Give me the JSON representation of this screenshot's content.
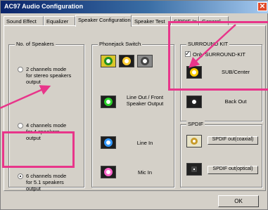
{
  "window": {
    "title": "AC97 Audio Configuration",
    "close_glyph": "✕"
  },
  "tabs": [
    {
      "label": "Sound Effect"
    },
    {
      "label": "Equalizer"
    },
    {
      "label": "Speaker Configuration"
    },
    {
      "label": "Speaker Test"
    },
    {
      "label": "S/PDIF-In"
    },
    {
      "label": "General"
    }
  ],
  "speakers_group": {
    "title": "No. of Speakers",
    "options": [
      {
        "label": "2 channels mode for stereo speakers output",
        "checked": false
      },
      {
        "label": "4 channels mode for 4 speakers output",
        "checked": false
      },
      {
        "label": "6 channels mode for 5.1 speakers output",
        "checked": true
      }
    ]
  },
  "phonejack_group": {
    "title": "Phonejack Switch",
    "jacks": [
      {
        "label": "Line Out / Front Speaker Output",
        "color": "#2bd12b"
      },
      {
        "label": "Line In",
        "color": "#3399ff"
      },
      {
        "label": "Mic In",
        "color": "#ff66cc"
      }
    ]
  },
  "surround_group": {
    "title": "SURROUND KIT",
    "checkbox_label": "Only SURROUND-KIT",
    "checkbox_checked": true,
    "items": [
      {
        "label": "SUB/Center"
      },
      {
        "label": "Back Out"
      }
    ]
  },
  "spdif_group": {
    "title": "SPDIF",
    "items": [
      {
        "label": "SPDIF out(coaxial)"
      },
      {
        "label": "SPDIF out(optical)"
      }
    ]
  },
  "ok_label": "OK",
  "colors": {
    "highlight": "#e8358a",
    "titlebar": "#0a246a"
  }
}
